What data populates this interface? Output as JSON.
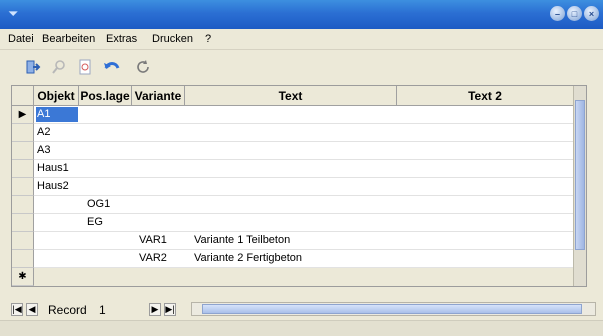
{
  "menu": {
    "items": [
      {
        "label": "Datei"
      },
      {
        "label": "Bearbeiten"
      },
      {
        "label": "Extras"
      },
      {
        "label": "Drucken"
      },
      {
        "label": "?"
      }
    ]
  },
  "toolbar": {
    "icons": [
      "exit-icon",
      "search-icon",
      "print-preview-icon",
      "undo-icon",
      "refresh-icon"
    ]
  },
  "grid": {
    "columns": [
      {
        "label": "Objekt"
      },
      {
        "label": "Pos.lage"
      },
      {
        "label": "Variante"
      },
      {
        "label": "Text"
      },
      {
        "label": "Text 2"
      }
    ],
    "rows": [
      {
        "objekt": "A1",
        "poslage": "",
        "variante": "",
        "text": "",
        "text2": ""
      },
      {
        "objekt": "A2",
        "poslage": "",
        "variante": "",
        "text": "",
        "text2": ""
      },
      {
        "objekt": "A3",
        "poslage": "",
        "variante": "",
        "text": "",
        "text2": ""
      },
      {
        "objekt": "Haus1",
        "poslage": "",
        "variante": "",
        "text": "",
        "text2": ""
      },
      {
        "objekt": "Haus2",
        "poslage": "",
        "variante": "",
        "text": "",
        "text2": ""
      },
      {
        "objekt": "",
        "poslage": "OG1",
        "variante": "",
        "text": "",
        "text2": ""
      },
      {
        "objekt": "",
        "poslage": "EG",
        "variante": "",
        "text": "",
        "text2": ""
      },
      {
        "objekt": "",
        "poslage": "",
        "variante": "VAR1",
        "text": "Variante 1 Teilbeton",
        "text2": ""
      },
      {
        "objekt": "",
        "poslage": "",
        "variante": "VAR2",
        "text": "Variante 2 Fertigbeton",
        "text2": ""
      }
    ],
    "current_row_marker": "▶",
    "new_row_marker": "✱"
  },
  "navigation": {
    "label": "Record",
    "value": "1",
    "first": "|◀",
    "prev": "◀",
    "next": "▶",
    "last": "▶|"
  }
}
